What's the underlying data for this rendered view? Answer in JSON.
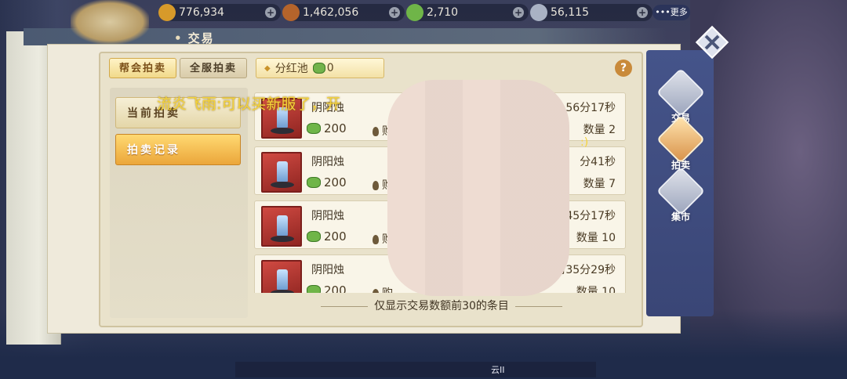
{
  "currencies": [
    {
      "name": "gold-coin",
      "value": "776,934",
      "color": "#d79a2a"
    },
    {
      "name": "copper-coin",
      "value": "1,462,056",
      "color": "#b5642b"
    },
    {
      "name": "jade",
      "value": "2,710",
      "color": "#6fb548"
    },
    {
      "name": "silver",
      "value": "56,115",
      "color": "#a9b2c4"
    }
  ],
  "more_label": "•••更多",
  "header_title": "交易",
  "tabs": {
    "guild": "帮会拍卖",
    "server": "全服拍卖"
  },
  "bonus_pool": {
    "label": "分红池",
    "value": "0"
  },
  "help": "?",
  "sidebar": {
    "current": "当前拍卖",
    "record": "拍卖记录"
  },
  "items": [
    {
      "name": "阴阳烛",
      "price": "200",
      "buyer": "购",
      "time": "56分17秒",
      "qty": "数量 2"
    },
    {
      "name": "阴阳烛",
      "price": "200",
      "buyer": "购",
      "time": "分41秒",
      "qty": "数量 7"
    },
    {
      "name": "阴阳烛",
      "price": "200",
      "buyer": "购",
      "time": "45分17秒",
      "qty": "数量 10"
    },
    {
      "name": "阴阳烛",
      "price": "200",
      "buyer": "购",
      "time": "2时35分29秒",
      "qty": "数量 10"
    }
  ],
  "footer_note": "仅显示交易数额前30的条目",
  "nav": [
    {
      "label": "交易",
      "icon": "scale-icon"
    },
    {
      "label": "拍卖",
      "icon": "gavel-icon"
    },
    {
      "label": "集市",
      "icon": "market-icon"
    }
  ],
  "chat": {
    "text": "流炎飞雨:可以买新服了，开",
    "tail": ":)"
  },
  "bottom_label": "云II"
}
